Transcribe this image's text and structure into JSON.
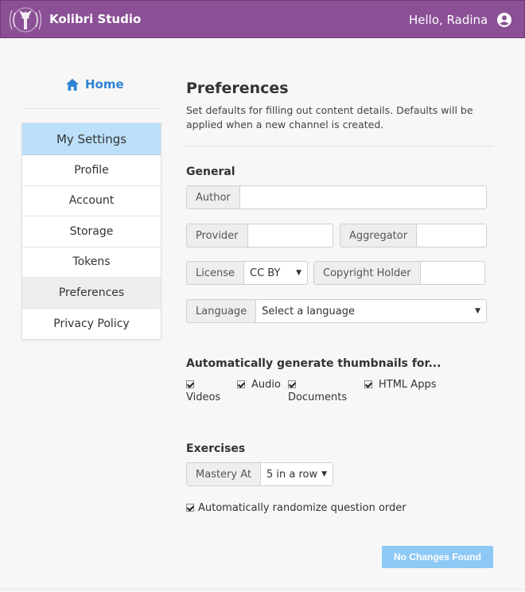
{
  "header": {
    "brand": "Kolibri Studio",
    "greeting": "Hello, Radina",
    "accent_color": "#8b4f95",
    "logo_icon": "kolibri-hummingbird-logo",
    "user_icon": "account-circle-icon"
  },
  "sidebar": {
    "home_label": "Home",
    "home_icon": "home-icon",
    "section_title": "My Settings",
    "items": [
      {
        "label": "Profile"
      },
      {
        "label": "Account"
      },
      {
        "label": "Storage"
      },
      {
        "label": "Tokens"
      },
      {
        "label": "Preferences"
      },
      {
        "label": "Privacy Policy"
      }
    ],
    "active_item": "Preferences"
  },
  "main": {
    "title": "Preferences",
    "description": "Set defaults for filling out content details. Defaults will be applied when a new channel is created.",
    "general": {
      "title": "General",
      "author_label": "Author",
      "author_value": "",
      "provider_label": "Provider",
      "provider_value": "",
      "aggregator_label": "Aggregator",
      "aggregator_value": "",
      "license_label": "License",
      "license_value": "CC BY",
      "copyright_label": "Copyright Holder",
      "copyright_value": "",
      "language_label": "Language",
      "language_value": "Select a language"
    },
    "thumbnails": {
      "title": "Automatically generate thumbnails for...",
      "options": [
        {
          "label": "Videos",
          "checked": true
        },
        {
          "label": "Audio",
          "checked": true
        },
        {
          "label": "Documents",
          "checked": true
        },
        {
          "label": "HTML Apps",
          "checked": true
        }
      ]
    },
    "exercises": {
      "title": "Exercises",
      "mastery_label": "Mastery At",
      "mastery_value": "5 in a row",
      "randomize_label": "Automatically randomize question order",
      "randomize_checked": true
    },
    "save_label": "No Changes Found",
    "save_color": "#8ec9f5"
  }
}
